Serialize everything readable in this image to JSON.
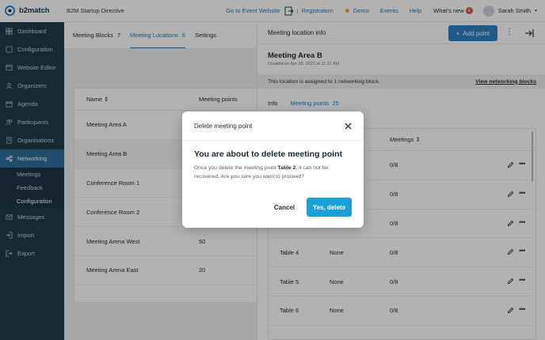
{
  "topbar": {
    "logo": "b2match",
    "event_name": "B2M Startup Directive",
    "go_to_event": "Go to Event Website",
    "separator": "|",
    "registration": "Registration",
    "demo": "Demo",
    "events": "Events",
    "help": "Help",
    "whats_new": "What's new",
    "whats_new_badge": "4",
    "user_name": "Sarah Smith",
    "colors": {
      "brand": "#1d3443",
      "link": "#1f7bc1",
      "demo_dot": "#f0a73c",
      "badge": "#e2564a"
    }
  },
  "sidebar": {
    "items": [
      {
        "label": "Dashboard",
        "icon": "dashboard-icon"
      },
      {
        "label": "Configuration",
        "icon": "configuration-icon"
      },
      {
        "label": "Website Editor",
        "icon": "website-editor-icon"
      },
      {
        "label": "Organizers",
        "icon": "organizers-icon"
      },
      {
        "label": "Agenda",
        "icon": "agenda-icon"
      },
      {
        "label": "Participants",
        "icon": "participants-icon"
      },
      {
        "label": "Organisations",
        "icon": "organisations-icon"
      },
      {
        "label": "Networking",
        "icon": "networking-icon",
        "active": true
      },
      {
        "label": "Messages",
        "icon": "messages-icon"
      },
      {
        "label": "Import",
        "icon": "import-icon"
      },
      {
        "label": "Export",
        "icon": "export-icon"
      }
    ],
    "networking_sub": [
      {
        "label": "Meetings"
      },
      {
        "label": "Feedback"
      },
      {
        "label": "Configuration",
        "active": true
      }
    ],
    "colors": {
      "background": "#223c4b",
      "active": "#2f6f9a"
    }
  },
  "main": {
    "tabs": [
      {
        "label": "Meeting Blocks",
        "count": "7"
      },
      {
        "label": "Meeting Locations",
        "count": "6",
        "active": true
      },
      {
        "label": "Settings",
        "count": ""
      }
    ],
    "table": {
      "columns": [
        "Name",
        "Meeting points"
      ],
      "rows": [
        {
          "name": "Meeting Area A",
          "points": ""
        },
        {
          "name": "Meeting Area B",
          "points": "",
          "selected": true
        },
        {
          "name": "Conference Room 1",
          "points": ""
        },
        {
          "name": "Conference Room 2",
          "points": ""
        },
        {
          "name": "Meeting Arena West",
          "points": "50"
        },
        {
          "name": "Meeting Arena East",
          "points": "20"
        }
      ]
    }
  },
  "panel": {
    "header": "Meeting location info",
    "add_point": "Add point",
    "title": "Meeting Area B",
    "created": "Created on Apr 28, 2023 at 11:11 AM.",
    "assigned_text": "This location is assigned to 1 networking block.",
    "view_blocks": "View networking blocks",
    "tabs": [
      {
        "label": "Info"
      },
      {
        "label": "Meeting points",
        "count": "25",
        "active": true
      }
    ],
    "table": {
      "columns": [
        "",
        "",
        "Meetings"
      ],
      "rows": [
        {
          "name": "",
          "type": "",
          "meetings": "0/8"
        },
        {
          "name": "",
          "type": "",
          "meetings": "0/8"
        },
        {
          "name": "",
          "type": "",
          "meetings": "0/8"
        },
        {
          "name": "Table 4",
          "type": "None",
          "meetings": "0/8"
        },
        {
          "name": "Table 5",
          "type": "None",
          "meetings": "0/8"
        },
        {
          "name": "Table 6",
          "type": "None",
          "meetings": "0/8"
        }
      ]
    },
    "colors": {
      "accent": "#2a80c6"
    }
  },
  "modal": {
    "header": "Delete meeting point",
    "title": "You are about to delete meeting point",
    "body_prefix": "Once you delete the meeting point ",
    "point_name": "Table 2",
    "body_suffix": ", it can not be recovered. Are you sure you want to proceed?",
    "cancel": "Cancel",
    "confirm": "Yes, delete",
    "colors": {
      "confirm": "#1b9fd7"
    }
  }
}
